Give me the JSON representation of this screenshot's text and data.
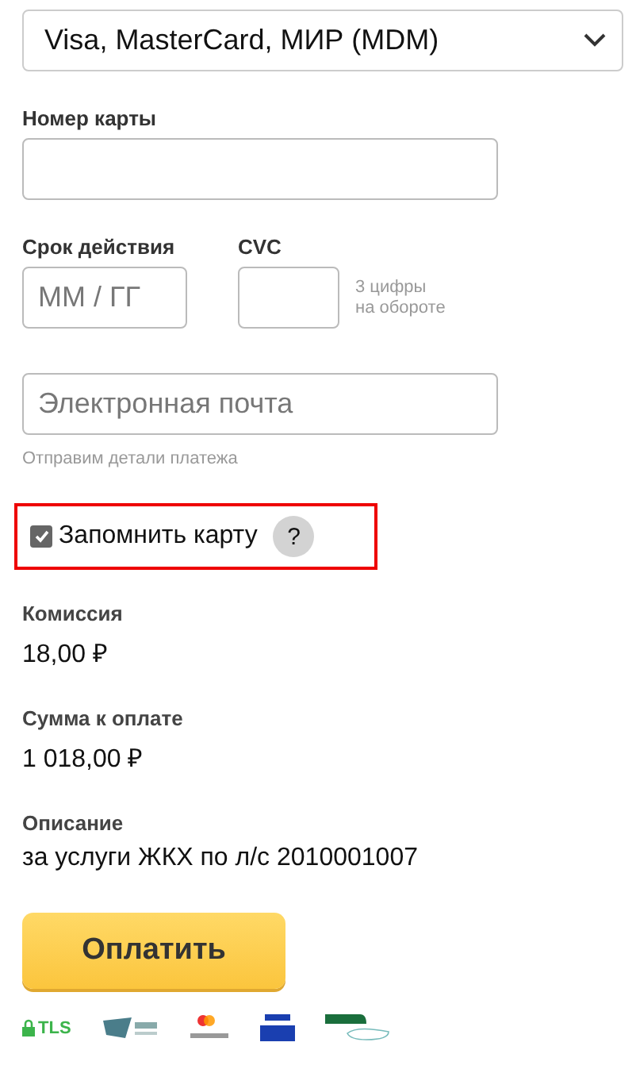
{
  "payment_system": {
    "value": "Visa, MasterCard, МИР (MDM)"
  },
  "card_number": {
    "label": "Номер карты"
  },
  "expiry": {
    "label": "Срок действия",
    "placeholder": "ММ / ГГ"
  },
  "cvc": {
    "label": "CVC",
    "hint_line_1": "3 цифры",
    "hint_line_2": "на обороте"
  },
  "email": {
    "placeholder": "Электронная почта",
    "hint": "Отправим детали платежа"
  },
  "remember_card": {
    "label": "Запомнить карту",
    "checked": true,
    "help": "?"
  },
  "summary": [
    {
      "label": "Комиссия",
      "value": "18,00 ₽"
    },
    {
      "label": "Сумма к оплате",
      "value": "1 018,00 ₽"
    },
    {
      "label": "Описание",
      "value": "за услуги ЖКХ по л/с 2010001007"
    }
  ],
  "pay_button": "Оплатить",
  "security": {
    "tls": "TLS"
  }
}
